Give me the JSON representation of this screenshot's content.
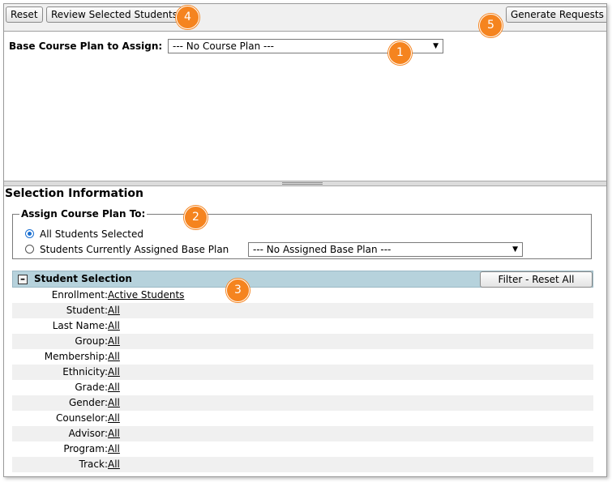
{
  "toolbar": {
    "reset_label": "Reset",
    "review_label": "Review Selected Students",
    "generate_label": "Generate Requests"
  },
  "badges": [
    "1",
    "2",
    "3",
    "4",
    "5"
  ],
  "base_plan": {
    "label": "Base Course Plan to Assign:",
    "selected": "--- No Course Plan ---"
  },
  "selection": {
    "title": "Selection Information",
    "assign_legend": "Assign Course Plan To:",
    "option_all": "All Students Selected",
    "option_base": "Students Currently Assigned Base Plan",
    "base_plan_selected": "--- No Assigned Base Plan ---",
    "selected_option": "all"
  },
  "student_selection": {
    "title": "Student Selection",
    "filter_reset_label": "Filter - Reset All",
    "rows": [
      {
        "label": "Enrollment:",
        "value": "Active Students"
      },
      {
        "label": "Student:",
        "value": "All"
      },
      {
        "label": "Last Name:",
        "value": "All"
      },
      {
        "label": "Group:",
        "value": "All"
      },
      {
        "label": "Membership:",
        "value": "All"
      },
      {
        "label": "Ethnicity:",
        "value": "All"
      },
      {
        "label": "Grade:",
        "value": "All"
      },
      {
        "label": "Gender:",
        "value": "All"
      },
      {
        "label": "Counselor:",
        "value": "All"
      },
      {
        "label": "Advisor:",
        "value": "All"
      },
      {
        "label": "Program:",
        "value": "All"
      },
      {
        "label": "Track:",
        "value": "All"
      }
    ]
  },
  "colors": {
    "badge": "#f5841f",
    "panel_header": "#b6d2dc",
    "radio_accent": "#1a6fd1"
  }
}
